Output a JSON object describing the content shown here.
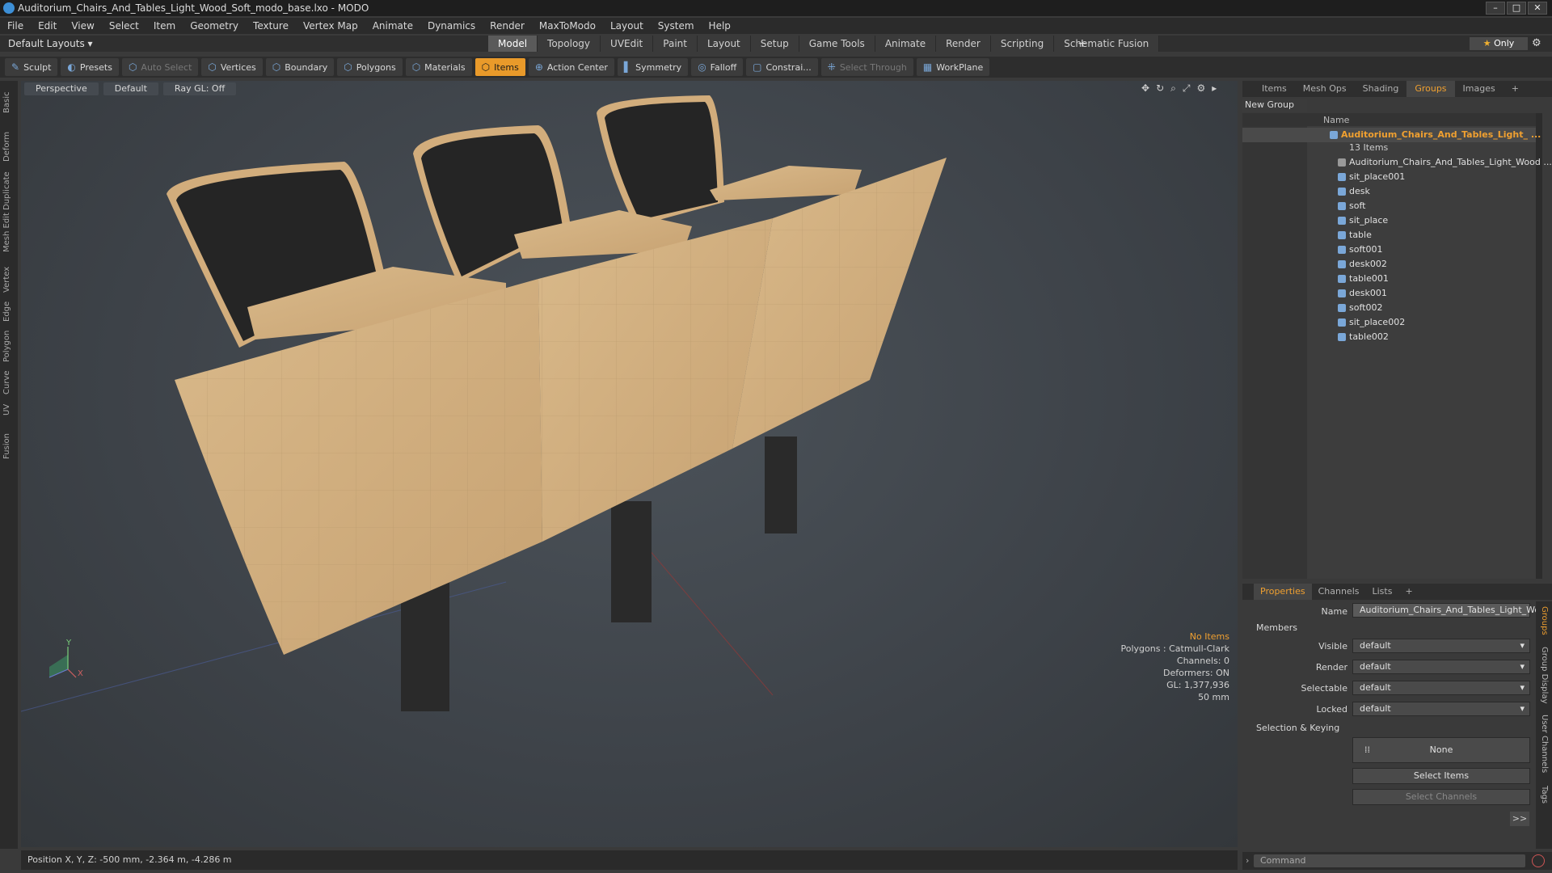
{
  "window": {
    "title": "Auditorium_Chairs_And_Tables_Light_Wood_Soft_modo_base.lxo - MODO",
    "buttons": [
      "–",
      "□",
      "✕"
    ]
  },
  "menu": [
    "File",
    "Edit",
    "View",
    "Select",
    "Item",
    "Geometry",
    "Texture",
    "Vertex Map",
    "Animate",
    "Dynamics",
    "Render",
    "MaxToModo",
    "Layout",
    "System",
    "Help"
  ],
  "layoutbar": {
    "default_layouts": "Default Layouts ▾",
    "tabs": [
      "Model",
      "Topology",
      "UVEdit",
      "Paint",
      "Layout",
      "Setup",
      "Game Tools",
      "Animate",
      "Render",
      "Scripting",
      "Schematic Fusion"
    ],
    "active_tab": "Model",
    "plus": "+",
    "only": "Only"
  },
  "toolbar": {
    "sculpt": "Sculpt",
    "presets": "Presets",
    "auto_select": "Auto Select",
    "vertices": "Vertices",
    "boundary": "Boundary",
    "polygons": "Polygons",
    "materials": "Materials",
    "items": "Items",
    "action_center": "Action Center",
    "symmetry": "Symmetry",
    "falloff": "Falloff",
    "constraints": "Constrai...",
    "select_through": "Select Through",
    "workplane": "WorkPlane"
  },
  "leftstrip": [
    "Basic",
    "Deform",
    "Duplicate",
    "Mesh Edit",
    "Vertex",
    "Edge",
    "Polygon",
    "Curve",
    "UV",
    "Fusion"
  ],
  "viewport": {
    "view": "Perspective",
    "shading": "Default",
    "raygl": "Ray GL: Off",
    "info": {
      "items": "No Items",
      "polygons": "Polygons : Catmull-Clark",
      "channels": "Channels: 0",
      "deformers": "Deformers: ON",
      "gl": "GL: 1,377,936",
      "scale": "50 mm"
    },
    "axis_labels": {
      "y": "Y",
      "x": "X"
    }
  },
  "status": {
    "position": "Position X, Y, Z:  -500 mm, -2.364 m, -4.286 m"
  },
  "right_panel": {
    "tabs": [
      "Items",
      "Mesh Ops",
      "Shading",
      "Groups",
      "Images",
      "+"
    ],
    "active_tab": "Groups",
    "new_group": "New Group",
    "name_col": "Name",
    "group_name": "Auditorium_Chairs_And_Tables_Light_ ...",
    "item_count": "13 Items",
    "items": [
      "Auditorium_Chairs_And_Tables_Light_Wood ...",
      "sit_place001",
      "desk",
      "soft",
      "sit_place",
      "table",
      "soft001",
      "desk002",
      "table001",
      "desk001",
      "soft002",
      "sit_place002",
      "table002"
    ]
  },
  "properties": {
    "tabs": [
      "Properties",
      "Channels",
      "Lists",
      "+"
    ],
    "active_tab": "Properties",
    "name_label": "Name",
    "name_value": "Auditorium_Chairs_And_Tables_Light_Wooc",
    "members": "Members",
    "visible_label": "Visible",
    "visible_value": "default",
    "render_label": "Render",
    "render_value": "default",
    "selectable_label": "Selectable",
    "selectable_value": "default",
    "locked_label": "Locked",
    "locked_value": "default",
    "selection_keying": "Selection & Keying",
    "none": "None",
    "select_items": "Select Items",
    "select_channels": "Select Channels",
    "more": ">>",
    "vtabs": [
      "Groups",
      "Group Display",
      "User Channels",
      "Tags"
    ]
  },
  "command": {
    "placeholder": "Command"
  }
}
